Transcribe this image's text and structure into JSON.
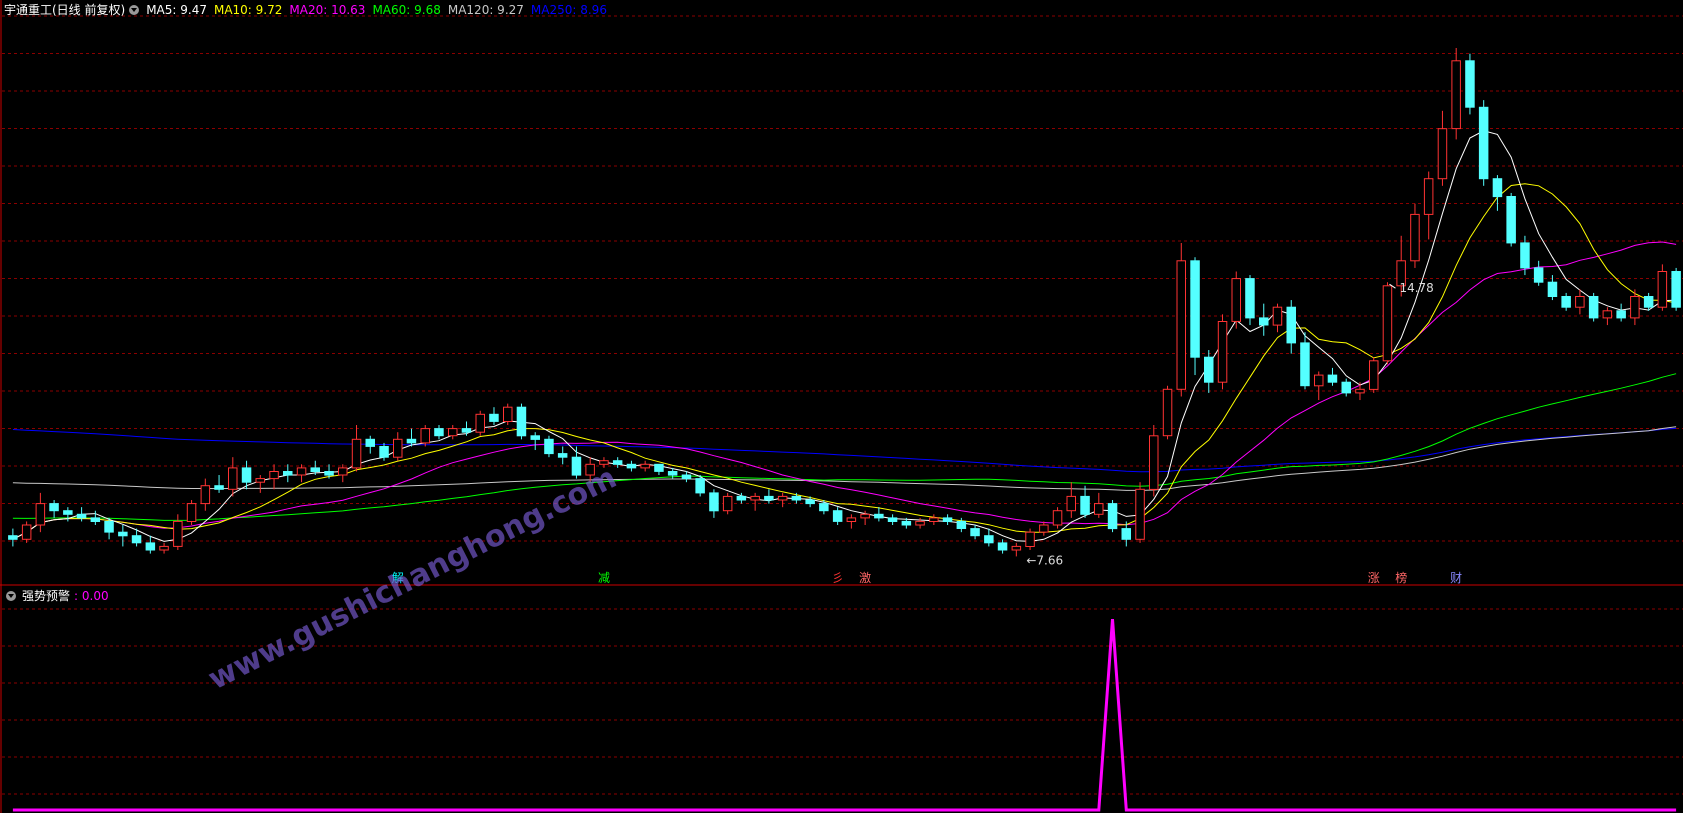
{
  "header": {
    "stock_title": "宇通重工(日线 前复权)",
    "ma_legend": [
      {
        "label": "MA5: 9.47",
        "color": "#ffffff"
      },
      {
        "label": "MA10: 9.72",
        "color": "#ffff00"
      },
      {
        "label": "MA20: 10.63",
        "color": "#ff00ff"
      },
      {
        "label": "MA60: 9.68",
        "color": "#00ff00"
      },
      {
        "label": "MA120: 9.27",
        "color": "#c8c8c8"
      },
      {
        "label": "MA250: 8.96",
        "color": "#0000ff"
      }
    ]
  },
  "sub_panel": {
    "label": "强势预警",
    "value_text": ": 0.00",
    "label_color": "#ffffff",
    "value_color": "#ff00ff",
    "line_color": "#ff00ff"
  },
  "watermark": "www.gushichanghong.com",
  "colors": {
    "up": "#ff3333",
    "down": "#54ffff",
    "grid": "#8b0000",
    "ma5": "#ffffff",
    "ma10": "#ffff00",
    "ma20": "#ff00ff",
    "ma60": "#00ff00",
    "ma120": "#c8c8c8",
    "ma250": "#0000ff"
  },
  "chart_data": {
    "type": "candlestick",
    "price_range": [
      7.4,
      15.2
    ],
    "indicator_range": [
      0,
      1.1
    ],
    "annotations": {
      "high_label": "14.78",
      "low_label": "7.66",
      "high_bar": 100,
      "low_bar": 73
    },
    "signals": [
      {
        "bar": 28,
        "text": "解",
        "color": "#00ffff"
      },
      {
        "bar": 43,
        "text": "减",
        "color": "#00ff00"
      },
      {
        "bar": 60,
        "text": "彡",
        "color": "#ff3333"
      },
      {
        "bar": 62,
        "text": "激",
        "color": "#ff6666"
      },
      {
        "bar": 99,
        "text": "涨",
        "color": "#ff6666"
      },
      {
        "bar": 101,
        "text": "榜",
        "color": "#ff6666"
      },
      {
        "bar": 105,
        "text": "财",
        "color": "#8888ff"
      }
    ],
    "indicator_spikes": [
      {
        "bar": 80,
        "value": 1
      }
    ],
    "ohlc": [
      [
        7.95,
        8.05,
        7.8,
        7.9
      ],
      [
        7.9,
        8.15,
        7.85,
        8.1
      ],
      [
        8.1,
        8.55,
        8.0,
        8.4
      ],
      [
        8.4,
        8.45,
        8.2,
        8.3
      ],
      [
        8.3,
        8.35,
        8.15,
        8.25
      ],
      [
        8.25,
        8.35,
        8.15,
        8.2
      ],
      [
        8.2,
        8.3,
        8.1,
        8.15
      ],
      [
        8.15,
        8.2,
        7.9,
        8.0
      ],
      [
        8.0,
        8.1,
        7.8,
        7.95
      ],
      [
        7.95,
        8.05,
        7.8,
        7.85
      ],
      [
        7.85,
        7.95,
        7.7,
        7.75
      ],
      [
        7.75,
        7.85,
        7.7,
        7.8
      ],
      [
        7.8,
        8.25,
        7.75,
        8.15
      ],
      [
        8.15,
        8.45,
        8.1,
        8.4
      ],
      [
        8.4,
        8.75,
        8.3,
        8.65
      ],
      [
        8.65,
        8.8,
        8.55,
        8.6
      ],
      [
        8.6,
        9.05,
        8.5,
        8.9
      ],
      [
        8.9,
        9.0,
        8.6,
        8.7
      ],
      [
        8.7,
        8.8,
        8.55,
        8.75
      ],
      [
        8.75,
        8.95,
        8.6,
        8.85
      ],
      [
        8.85,
        8.95,
        8.7,
        8.8
      ],
      [
        8.8,
        8.95,
        8.7,
        8.9
      ],
      [
        8.9,
        9.0,
        8.8,
        8.85
      ],
      [
        8.85,
        8.95,
        8.75,
        8.8
      ],
      [
        8.8,
        8.95,
        8.7,
        8.9
      ],
      [
        8.9,
        9.5,
        8.85,
        9.3
      ],
      [
        9.3,
        9.35,
        9.1,
        9.2
      ],
      [
        9.2,
        9.25,
        9.0,
        9.05
      ],
      [
        9.05,
        9.4,
        9.0,
        9.3
      ],
      [
        9.3,
        9.45,
        9.2,
        9.25
      ],
      [
        9.25,
        9.5,
        9.2,
        9.45
      ],
      [
        9.45,
        9.5,
        9.3,
        9.35
      ],
      [
        9.35,
        9.5,
        9.3,
        9.45
      ],
      [
        9.45,
        9.55,
        9.35,
        9.4
      ],
      [
        9.4,
        9.7,
        9.35,
        9.65
      ],
      [
        9.65,
        9.75,
        9.5,
        9.55
      ],
      [
        9.55,
        9.8,
        9.5,
        9.75
      ],
      [
        9.75,
        9.8,
        9.3,
        9.35
      ],
      [
        9.35,
        9.4,
        9.15,
        9.3
      ],
      [
        9.3,
        9.35,
        9.05,
        9.1
      ],
      [
        9.1,
        9.2,
        8.95,
        9.05
      ],
      [
        9.05,
        9.2,
        8.75,
        8.8
      ],
      [
        8.8,
        9.05,
        8.7,
        8.95
      ],
      [
        8.95,
        9.05,
        8.9,
        9.0
      ],
      [
        9.0,
        9.05,
        8.9,
        8.95
      ],
      [
        8.95,
        9.0,
        8.85,
        8.9
      ],
      [
        8.9,
        9.0,
        8.85,
        8.95
      ],
      [
        8.95,
        8.95,
        8.8,
        8.85
      ],
      [
        8.85,
        8.9,
        8.75,
        8.8
      ],
      [
        8.8,
        8.85,
        8.7,
        8.75
      ],
      [
        8.75,
        8.8,
        8.5,
        8.55
      ],
      [
        8.55,
        8.6,
        8.2,
        8.3
      ],
      [
        8.3,
        8.55,
        8.25,
        8.5
      ],
      [
        8.5,
        8.55,
        8.4,
        8.45
      ],
      [
        8.45,
        8.55,
        8.3,
        8.5
      ],
      [
        8.5,
        8.6,
        8.4,
        8.45
      ],
      [
        8.45,
        8.55,
        8.35,
        8.5
      ],
      [
        8.5,
        8.55,
        8.4,
        8.45
      ],
      [
        8.45,
        8.5,
        8.35,
        8.4
      ],
      [
        8.4,
        8.45,
        8.25,
        8.3
      ],
      [
        8.3,
        8.35,
        8.1,
        8.15
      ],
      [
        8.15,
        8.25,
        8.05,
        8.2
      ],
      [
        8.2,
        8.3,
        8.1,
        8.25
      ],
      [
        8.25,
        8.35,
        8.15,
        8.2
      ],
      [
        8.2,
        8.25,
        8.1,
        8.15
      ],
      [
        8.15,
        8.2,
        8.05,
        8.1
      ],
      [
        8.1,
        8.2,
        8.05,
        8.15
      ],
      [
        8.15,
        8.25,
        8.1,
        8.2
      ],
      [
        8.2,
        8.25,
        8.1,
        8.15
      ],
      [
        8.15,
        8.2,
        8.0,
        8.05
      ],
      [
        8.05,
        8.1,
        7.9,
        7.95
      ],
      [
        7.95,
        8.05,
        7.8,
        7.85
      ],
      [
        7.85,
        7.9,
        7.7,
        7.75
      ],
      [
        7.75,
        7.85,
        7.66,
        7.8
      ],
      [
        7.8,
        8.05,
        7.75,
        8.0
      ],
      [
        8.0,
        8.15,
        7.95,
        8.1
      ],
      [
        8.1,
        8.35,
        8.05,
        8.3
      ],
      [
        8.3,
        8.7,
        8.2,
        8.5
      ],
      [
        8.5,
        8.65,
        8.2,
        8.25
      ],
      [
        8.25,
        8.55,
        8.2,
        8.4
      ],
      [
        8.4,
        8.45,
        8.0,
        8.05
      ],
      [
        8.05,
        8.15,
        7.8,
        7.9
      ],
      [
        7.9,
        8.7,
        7.85,
        8.6
      ],
      [
        8.6,
        9.5,
        8.5,
        9.35
      ],
      [
        9.35,
        10.05,
        9.3,
        10.0
      ],
      [
        10.0,
        12.05,
        9.9,
        11.8
      ],
      [
        11.8,
        11.85,
        10.2,
        10.45
      ],
      [
        10.45,
        10.55,
        9.95,
        10.1
      ],
      [
        10.1,
        11.05,
        10.0,
        10.95
      ],
      [
        10.95,
        11.65,
        10.85,
        11.55
      ],
      [
        11.55,
        11.6,
        10.9,
        11.0
      ],
      [
        11.0,
        11.2,
        10.75,
        10.9
      ],
      [
        10.9,
        11.2,
        10.8,
        11.15
      ],
      [
        11.15,
        11.25,
        10.5,
        10.65
      ],
      [
        10.65,
        10.8,
        10.0,
        10.05
      ],
      [
        10.05,
        10.25,
        9.85,
        10.2
      ],
      [
        10.2,
        10.3,
        10.05,
        10.1
      ],
      [
        10.1,
        10.15,
        9.9,
        9.95
      ],
      [
        9.95,
        10.1,
        9.85,
        10.0
      ],
      [
        10.0,
        10.45,
        9.95,
        10.4
      ],
      [
        10.4,
        11.5,
        10.35,
        11.45
      ],
      [
        11.45,
        12.15,
        11.3,
        11.8
      ],
      [
        11.8,
        12.6,
        11.7,
        12.45
      ],
      [
        12.45,
        13.05,
        12.1,
        12.95
      ],
      [
        12.95,
        13.9,
        12.85,
        13.65
      ],
      [
        13.65,
        14.78,
        13.5,
        14.6
      ],
      [
        14.6,
        14.7,
        13.85,
        13.95
      ],
      [
        13.95,
        14.05,
        12.85,
        12.95
      ],
      [
        12.95,
        13.0,
        12.5,
        12.7
      ],
      [
        12.7,
        12.75,
        12.0,
        12.05
      ],
      [
        12.05,
        12.15,
        11.6,
        11.7
      ],
      [
        11.7,
        11.8,
        11.45,
        11.5
      ],
      [
        11.5,
        11.6,
        11.25,
        11.3
      ],
      [
        11.3,
        11.35,
        11.1,
        11.15
      ],
      [
        11.15,
        11.4,
        11.05,
        11.3
      ],
      [
        11.3,
        11.35,
        10.95,
        11.0
      ],
      [
        11.0,
        11.15,
        10.9,
        11.1
      ],
      [
        11.1,
        11.2,
        10.95,
        11.0
      ],
      [
        11.0,
        11.4,
        10.9,
        11.3
      ],
      [
        11.3,
        11.35,
        11.1,
        11.15
      ],
      [
        11.15,
        11.75,
        11.1,
        11.65
      ],
      [
        11.65,
        11.7,
        11.1,
        11.15
      ]
    ]
  }
}
